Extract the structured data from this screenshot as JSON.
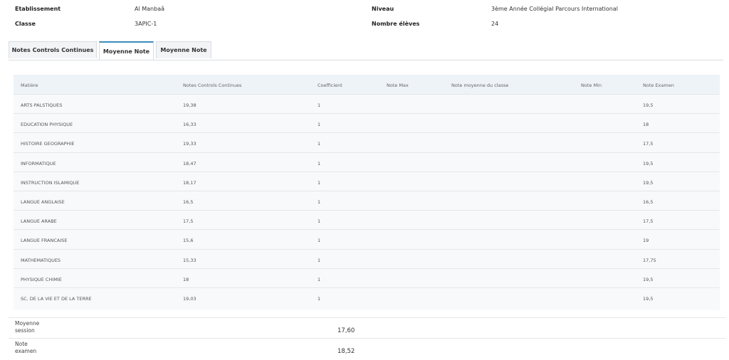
{
  "info": {
    "etablissement_label": "Etablissement",
    "etablissement_value": "Al Manbaâ",
    "classe_label": "Classe",
    "classe_value": "3APIC-1",
    "niveau_label": "Niveau",
    "niveau_value": "3ème Année Collégial Parcours International",
    "nombre_label": "Nombre élèves",
    "nombre_value": "24"
  },
  "tabs": [
    {
      "label": "Notes Controls Continues"
    },
    {
      "label": "Moyenne Note"
    },
    {
      "label": "Moyenne Note"
    }
  ],
  "table": {
    "headers": [
      "Matière",
      "Notes Controls Continues",
      "Coefficient",
      "Note Max",
      "Note moyenne du classe",
      "Note Min",
      "Note Examen"
    ],
    "rows": [
      {
        "matiere": "ARTS PALSTIQUES",
        "ncc": "19,38",
        "coef": "1",
        "examen": "19,5"
      },
      {
        "matiere": "EDUCATION PHYSIQUE",
        "ncc": "16,33",
        "coef": "1",
        "examen": "18"
      },
      {
        "matiere": "HISTOIRE GEOGRAPHIE",
        "ncc": "19,33",
        "coef": "1",
        "examen": "17,5"
      },
      {
        "matiere": "INFORMATIQUE",
        "ncc": "18,47",
        "coef": "1",
        "examen": "19,5"
      },
      {
        "matiere": "INSTRUCTION ISLAMIQUE",
        "ncc": "18,17",
        "coef": "1",
        "examen": "19,5"
      },
      {
        "matiere": "LANGUE ANGLAISE",
        "ncc": "16,5",
        "coef": "1",
        "examen": "16,5"
      },
      {
        "matiere": "LANGUE ARABE",
        "ncc": "17,5",
        "coef": "1",
        "examen": "17,5"
      },
      {
        "matiere": "LANGUE FRANCAISE",
        "ncc": "15,6",
        "coef": "1",
        "examen": "19"
      },
      {
        "matiere": "MATHEMATIQUES",
        "ncc": "15,33",
        "coef": "1",
        "examen": "17,75"
      },
      {
        "matiere": "PHYSIQUE CHIMIE",
        "ncc": "18",
        "coef": "1",
        "examen": "19,5"
      },
      {
        "matiere": "SC. DE LA VIE ET DE LA TERRE",
        "ncc": "19,03",
        "coef": "1",
        "examen": "19,5"
      }
    ]
  },
  "summary": {
    "moyenne_session_label_1": "Moyenne",
    "moyenne_session_label_2": "session",
    "moyenne_session_value": "17,60",
    "note_examen_label_1": "Note",
    "note_examen_label_2": "examen",
    "note_examen_value": "18,52"
  }
}
